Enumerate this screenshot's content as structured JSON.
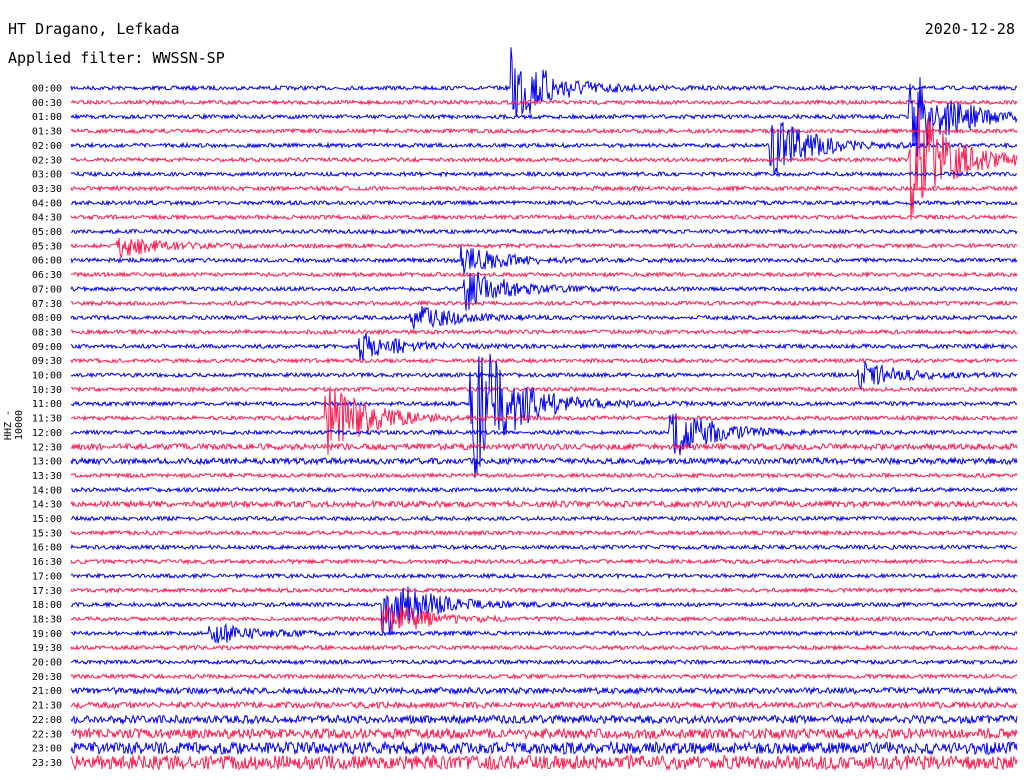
{
  "header": {
    "station": "HT Dragano, Lefkada",
    "filter": "Applied filter: WWSSN-SP",
    "date": "2020-12-28"
  },
  "channel_label": "HHZ - 10000",
  "colors": {
    "even": "#0000ee",
    "odd": "#ff1a4d",
    "text": "#000000"
  },
  "chart_data": {
    "type": "line",
    "title": "HT Dragano, Lefkada",
    "subtitle": "Applied filter: WWSSN-SP",
    "ylabel": "HHZ - 10000",
    "tick_labels": [
      "00:00",
      "00:30",
      "01:00",
      "01:30",
      "02:00",
      "02:30",
      "03:00",
      "03:30",
      "04:00",
      "04:30",
      "05:00",
      "05:30",
      "06:00",
      "06:30",
      "07:00",
      "07:30",
      "08:00",
      "08:30",
      "09:00",
      "09:30",
      "10:00",
      "10:30",
      "11:00",
      "11:30",
      "12:00",
      "12:30",
      "13:00",
      "13:30",
      "14:00",
      "14:30",
      "15:00",
      "15:30",
      "16:00",
      "16:30",
      "17:00",
      "17:30",
      "18:00",
      "18:30",
      "19:00",
      "19:30",
      "20:00",
      "20:30",
      "21:00",
      "21:30",
      "22:00",
      "22:30",
      "23:00",
      "23:30"
    ],
    "x_minutes_per_trace": 30,
    "noise_level": [
      2,
      2,
      2,
      2,
      2,
      2,
      2,
      2,
      2,
      2,
      2,
      2,
      2,
      2,
      2,
      2,
      2,
      2,
      2,
      2,
      2,
      2,
      2,
      2,
      2,
      3,
      3,
      2,
      2,
      3,
      2,
      2,
      2,
      2,
      2,
      2,
      2,
      2,
      2,
      2,
      2,
      2,
      3,
      3,
      4,
      5,
      6,
      7
    ],
    "events": [
      {
        "trace": 0,
        "minute": 14.0,
        "amp": 40
      },
      {
        "trace": 2,
        "minute": 26.6,
        "amp": 50
      },
      {
        "trace": 4,
        "minute": 22.2,
        "amp": 30
      },
      {
        "trace": 5,
        "minute": 26.6,
        "amp": 65
      },
      {
        "trace": 12,
        "minute": 12.4,
        "amp": 15
      },
      {
        "trace": 14,
        "minute": 12.5,
        "amp": 22
      },
      {
        "trace": 16,
        "minute": 10.8,
        "amp": 14
      },
      {
        "trace": 18,
        "minute": 9.1,
        "amp": 16
      },
      {
        "trace": 11,
        "minute": 1.5,
        "amp": 12
      },
      {
        "trace": 20,
        "minute": 25.0,
        "amp": 14
      },
      {
        "trace": 22,
        "minute": 12.7,
        "amp": 80
      },
      {
        "trace": 23,
        "minute": 8.1,
        "amp": 40
      },
      {
        "trace": 24,
        "minute": 19.0,
        "amp": 30
      },
      {
        "trace": 36,
        "minute": 9.9,
        "amp": 35
      },
      {
        "trace": 37,
        "minute": 9.9,
        "amp": 20
      },
      {
        "trace": 38,
        "minute": 4.4,
        "amp": 12
      }
    ]
  }
}
